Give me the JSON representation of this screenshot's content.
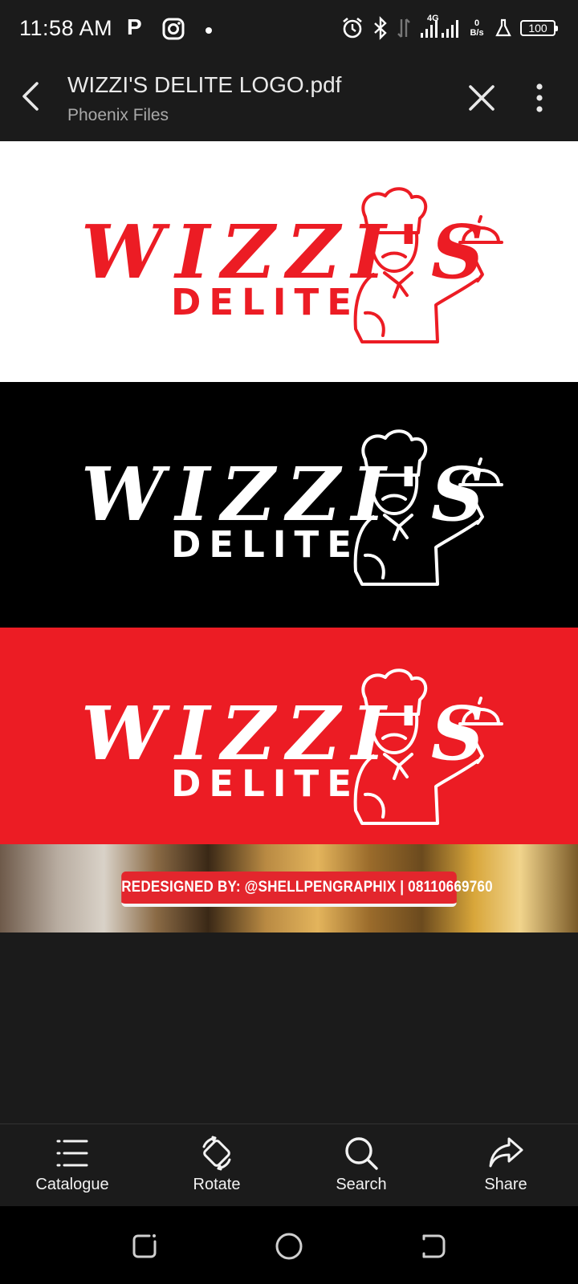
{
  "status_bar": {
    "time": "11:58 AM",
    "app_letter": "P",
    "network": "4G",
    "speed_value": "0",
    "speed_unit": "B/s",
    "battery": "100"
  },
  "app_bar": {
    "title": "WIZZI'S DELITE LOGO.pdf",
    "subtitle": "Phoenix Files"
  },
  "document": {
    "logo_word": "WIZZI'S",
    "logo_sub": "DELITE",
    "credit": "REDESIGNED BY: @SHELLPENGRAPHIX  |  08110669760",
    "colors": {
      "brand_red": "#ec1c24",
      "white": "#ffffff",
      "black": "#000000"
    }
  },
  "toolbar": [
    {
      "label": "Catalogue",
      "icon": "list-icon"
    },
    {
      "label": "Rotate",
      "icon": "rotate-icon"
    },
    {
      "label": "Search",
      "icon": "search-icon"
    },
    {
      "label": "Share",
      "icon": "share-icon"
    }
  ],
  "nav_bar": [
    "recents-button",
    "home-button",
    "back-button"
  ]
}
